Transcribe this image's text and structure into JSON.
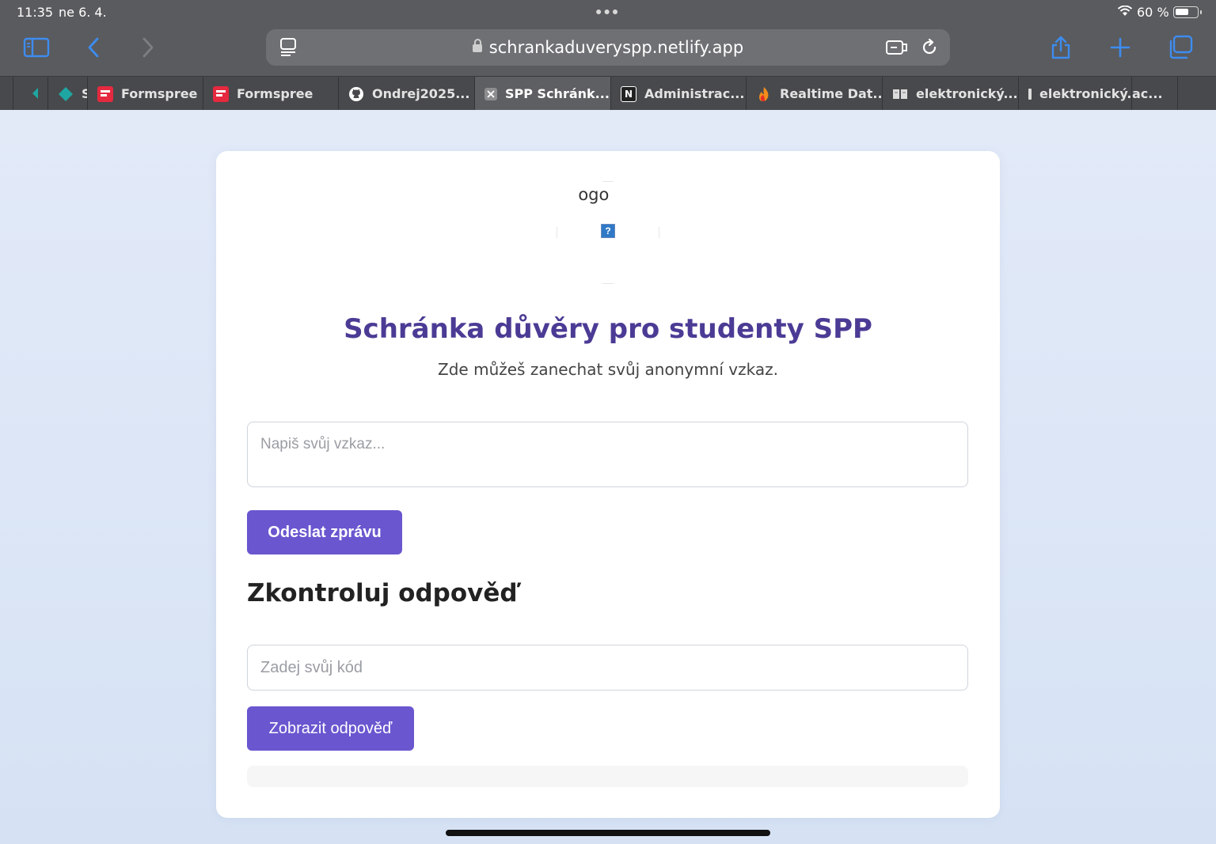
{
  "status_bar": {
    "time": "11:35",
    "date": "ne 6. 4.",
    "battery": "60 %",
    "battery_level": 0.6
  },
  "toolbar": {
    "url": "schrankaduveryspp.netlify.app",
    "icons": [
      "sidebar-icon",
      "back-icon",
      "forward-icon",
      "reader-icon",
      "extension-icon",
      "reload-icon",
      "share-icon",
      "new-tab-icon",
      "tabs-overview-icon"
    ]
  },
  "tabs": [
    {
      "label": "S",
      "icon": "diamond-icon",
      "color": "#1fa6a2"
    },
    {
      "label": "Formspree",
      "icon": "formspree-icon",
      "color": "#e5293f"
    },
    {
      "label": "Formspree",
      "icon": "formspree-icon",
      "color": "#e5293f"
    },
    {
      "label": "Ondrej2025...",
      "icon": "github-icon",
      "color": "#ffffff"
    },
    {
      "label": "SPP Schránk...",
      "icon": "close-tab-icon",
      "color": "#8d8d8f",
      "active": true
    },
    {
      "label": "Administrac...",
      "icon": "notion-icon",
      "color": "#ffffff"
    },
    {
      "label": "Realtime Dat...",
      "icon": "firebase-icon",
      "color": "#f5a623"
    },
    {
      "label": "elektronický...",
      "icon": "book-icon",
      "color": "#dddddd"
    },
    {
      "label": "elektronický...",
      "icon": "bar-icon",
      "color": "#dddddd"
    },
    {
      "label": "ac...",
      "icon": "",
      "color": ""
    }
  ],
  "page": {
    "logo_alt": "Logo",
    "title": "Schránka důvěry pro studenty SPP",
    "subtitle": "Zde můžeš zanechat svůj anonymní vzkaz.",
    "message_placeholder": "Napiš svůj vzkaz...",
    "send_button": "Odeslat zprávu",
    "check_heading": "Zkontroluj odpověď",
    "code_placeholder": "Zadej svůj kód",
    "show_button": "Zobrazit odpověď"
  },
  "colors": {
    "accent": "#6a56cf",
    "title": "#4c3b95",
    "chrome": "#5a5b5e"
  }
}
